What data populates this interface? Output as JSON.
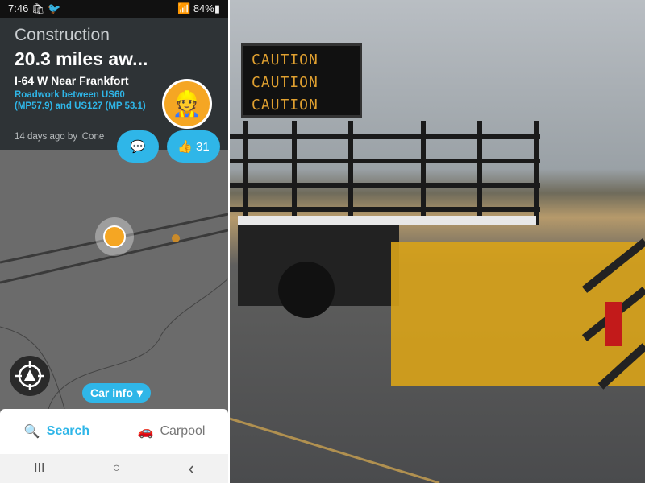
{
  "status_bar": {
    "time": "7:46",
    "battery": "84%",
    "icons": [
      "bag-icon",
      "twitter-icon",
      "mute-icon",
      "location-icon",
      "wifi-icon",
      "signal-icon",
      "battery-icon"
    ]
  },
  "alert": {
    "category": "Construction",
    "distance": "20.3 miles aw...",
    "road": "I-64 W Near Frankfort",
    "description": "Roadwork between US60 (MP57.9) and US127 (MP 53.1)",
    "posted": "14 days ago by iCone",
    "thumbs_count": "31",
    "icon": "construction-worker-icon"
  },
  "map": {
    "car_info_label": "Car info"
  },
  "bottom_bar": {
    "search_label": "Search",
    "carpool_label": "Carpool"
  },
  "android_nav": {
    "recents": "III",
    "home": "○",
    "back": "‹"
  },
  "photo": {
    "sign_lines": [
      "CAUTION",
      "CAUTION",
      "CAUTION"
    ]
  },
  "colors": {
    "accent": "#2fb6e8",
    "card_bg": "#2e3336",
    "badge": "#f5a623"
  }
}
